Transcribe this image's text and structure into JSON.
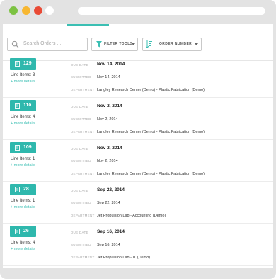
{
  "search": {
    "placeholder": "Search Orders ..."
  },
  "toolbar": {
    "filter_label": "FILTER TOOLS",
    "sort_label": "ORDER NUMBER"
  },
  "labels": {
    "due_date": "DUE DATE",
    "submitted": "SUBMITTED",
    "department": "DEPARTMENT",
    "more_details": "+ more details"
  },
  "colors": {
    "accent": "#2fb8ad",
    "link": "#3bbfb3"
  },
  "orders": [
    {
      "number": "129",
      "line_items": "Line Items: 3",
      "due": "Nov 14, 2014",
      "submitted": "Nov 14, 2014",
      "department": "Langley Research Center (Demo) - Plastic Fabrication (Demo)"
    },
    {
      "number": "110",
      "line_items": "Line Items: 4",
      "due": "Nov 2, 2014",
      "submitted": "Nov 2, 2014",
      "department": "Langley Research Center (Demo) - Plastic Fabrication (Demo)"
    },
    {
      "number": "109",
      "line_items": "Line Items: 1",
      "due": "Nov 2, 2014",
      "submitted": "Nov 2, 2014",
      "department": "Langley Research Center (Demo) - Plastic Fabrication (Demo)"
    },
    {
      "number": "28",
      "line_items": "Line Items: 1",
      "due": "Sep 22, 2014",
      "submitted": "Sep 22, 2014",
      "department": "Jet Propulsion Lab - Accounting (Demo)"
    },
    {
      "number": "26",
      "line_items": "Line Items: 4",
      "due": "Sep 16, 2014",
      "submitted": "Sep 16, 2014",
      "department": "Jet Propulsion Lab - IT (Demo)"
    }
  ]
}
